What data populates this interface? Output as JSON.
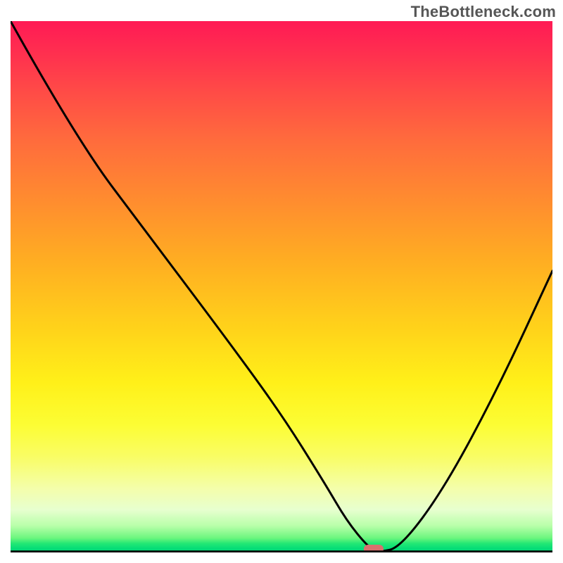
{
  "attribution": "TheBottleneck.com",
  "chart_data": {
    "type": "line",
    "title": "",
    "xlabel": "",
    "ylabel": "",
    "xlim": [
      0,
      100
    ],
    "ylim": [
      0,
      100
    ],
    "grid": false,
    "legend": false,
    "background": {
      "kind": "vertical-gradient-red-to-green",
      "stops": [
        {
          "pos": 0,
          "color": "#ff1a55"
        },
        {
          "pos": 33,
          "color": "#ff8a30"
        },
        {
          "pos": 58,
          "color": "#ffd31a"
        },
        {
          "pos": 76,
          "color": "#fcfd34"
        },
        {
          "pos": 88,
          "color": "#f4feab"
        },
        {
          "pos": 95,
          "color": "#b8ffa9"
        },
        {
          "pos": 100,
          "color": "#04d879"
        }
      ]
    },
    "series": [
      {
        "name": "bottleneck-curve",
        "color": "#000000",
        "x": [
          0,
          12,
          26,
          40,
          50,
          58,
          62,
          66,
          68,
          72,
          80,
          90,
          100
        ],
        "values": [
          100,
          78,
          59,
          40,
          26,
          13,
          6,
          1,
          0,
          1,
          12,
          31,
          53
        ]
      }
    ],
    "marker": {
      "name": "highlighted-point",
      "x": 67,
      "y": 0,
      "color": "#d9706e",
      "shape": "rounded-oval"
    }
  }
}
